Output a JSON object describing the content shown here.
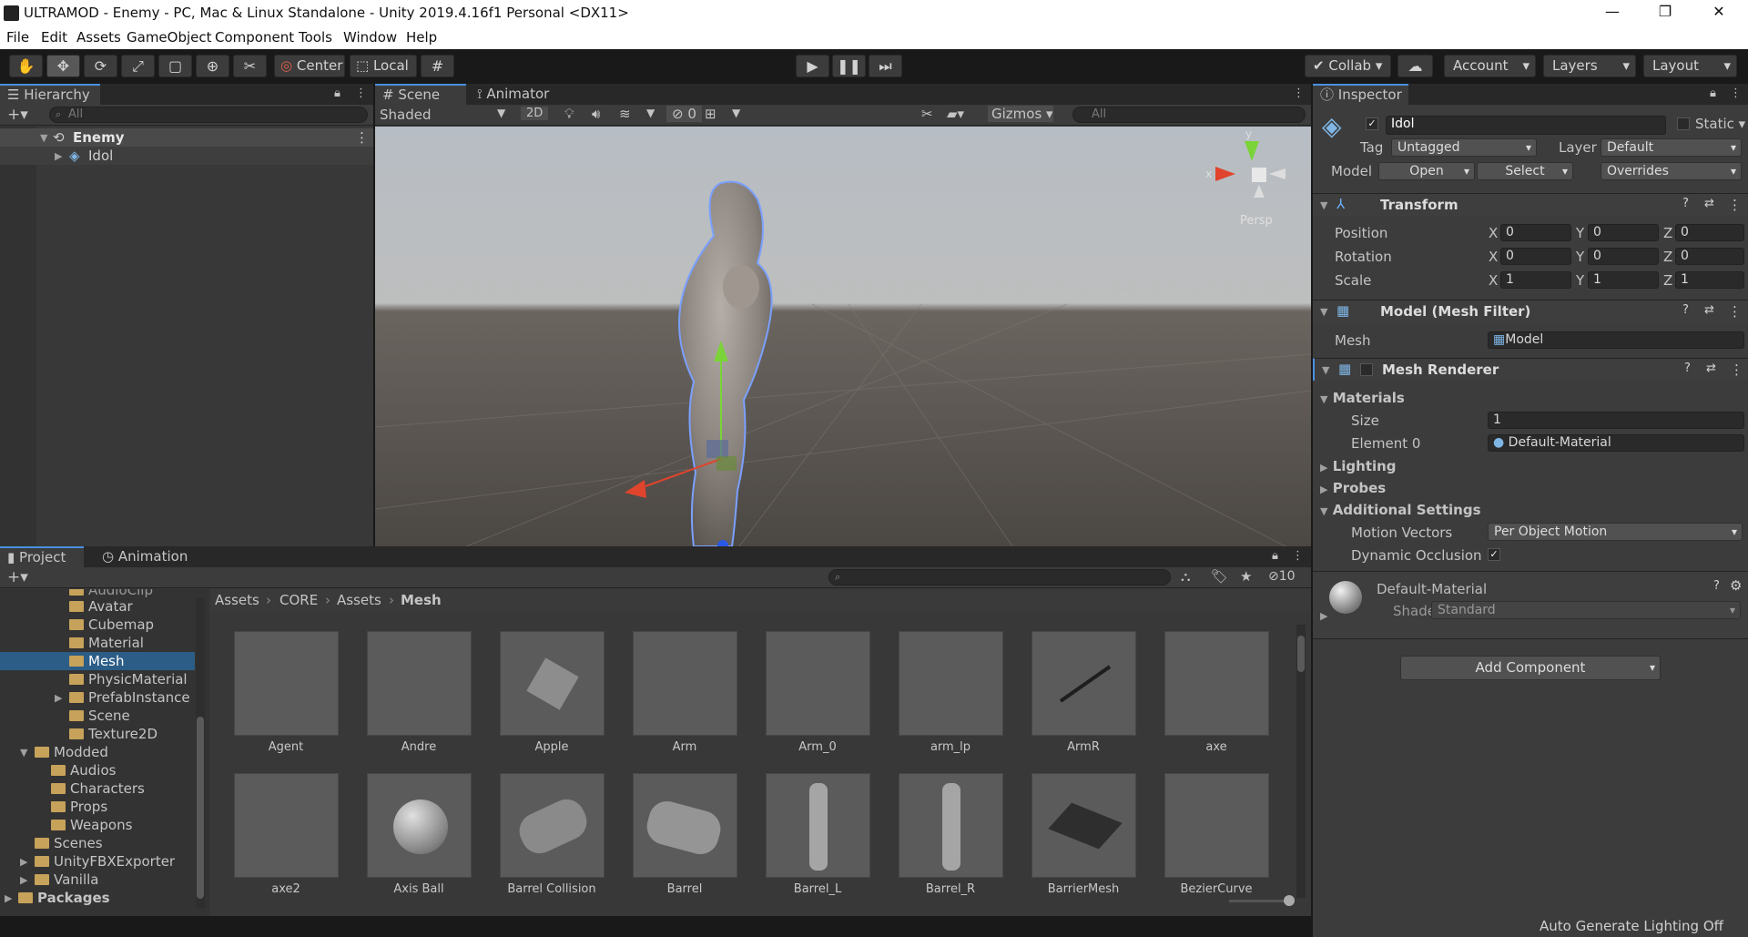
{
  "window": {
    "title": "ULTRAMOD - Enemy - PC, Mac & Linux Standalone - Unity 2019.4.16f1 Personal <DX11>"
  },
  "menu": [
    "File",
    "Edit",
    "Assets",
    "GameObject",
    "Component",
    "Tools",
    "Window",
    "Help"
  ],
  "toolbar": {
    "pivot": "Center",
    "space": "Local",
    "collab": "Collab",
    "account": "Account",
    "layers": "Layers",
    "layout": "Layout"
  },
  "hierarchy": {
    "tab": "Hierarchy",
    "search_placeholder": "All",
    "scene": "Enemy",
    "child": "Idol"
  },
  "scene": {
    "tab_scene": "Scene",
    "tab_animator": "Animator",
    "shading": "Shaded",
    "mode2d": "2D",
    "hidden_count": "0",
    "gizmos": "Gizmos",
    "search_placeholder": "All",
    "axis_x": "x",
    "axis_y": "y",
    "persp": "Persp"
  },
  "inspector": {
    "tab": "Inspector",
    "object_name": "Idol",
    "static_label": "Static",
    "tag_label": "Tag",
    "tag_value": "Untagged",
    "layer_label": "Layer",
    "layer_value": "Default",
    "model_label": "Model",
    "open": "Open",
    "select": "Select",
    "overrides": "Overrides",
    "transform": {
      "title": "Transform",
      "position": "Position",
      "rotation": "Rotation",
      "scale": "Scale",
      "pos": [
        "0",
        "0",
        "0"
      ],
      "rot": [
        "0",
        "0",
        "0"
      ],
      "scl": [
        "1",
        "1",
        "1"
      ],
      "x": "X",
      "y": "Y",
      "z": "Z"
    },
    "mesh_filter": {
      "title": "Model (Mesh Filter)",
      "mesh_label": "Mesh",
      "mesh_value": "Model"
    },
    "mesh_renderer": {
      "title": "Mesh Renderer",
      "materials": "Materials",
      "size_label": "Size",
      "size_value": "1",
      "element_label": "Element 0",
      "element_value": "Default-Material",
      "lighting": "Lighting",
      "probes": "Probes",
      "additional": "Additional Settings",
      "motion_label": "Motion Vectors",
      "motion_value": "Per Object Motion",
      "occlusion_label": "Dynamic Occlusion"
    },
    "material": {
      "name": "Default-Material",
      "shader_label": "Shader",
      "shader_value": "Standard"
    },
    "add_component": "Add Component"
  },
  "project": {
    "tab_project": "Project",
    "tab_animation": "Animation",
    "hidden_count": "10",
    "breadcrumb": [
      "Assets",
      "CORE",
      "Assets",
      "Mesh"
    ],
    "tree": [
      "AudioClip",
      "Avatar",
      "Cubemap",
      "Material",
      "Mesh",
      "PhysicMaterial",
      "PrefabInstance",
      "Scene",
      "Texture2D",
      "Modded",
      "Audios",
      "Characters",
      "Props",
      "Weapons",
      "Scenes",
      "UnityFBXExporter",
      "Vanilla",
      "Packages"
    ],
    "assets_row1": [
      "Agent",
      "Andre",
      "Apple",
      "Arm",
      "Arm_0",
      "arm_lp",
      "ArmR",
      "axe"
    ],
    "assets_row2": [
      "axe2",
      "Axis Ball",
      "Barrel Collision",
      "Barrel",
      "Barrel_L",
      "Barrel_R",
      "BarrierMesh",
      "BezierCurve"
    ]
  },
  "status": "Auto Generate Lighting Off"
}
